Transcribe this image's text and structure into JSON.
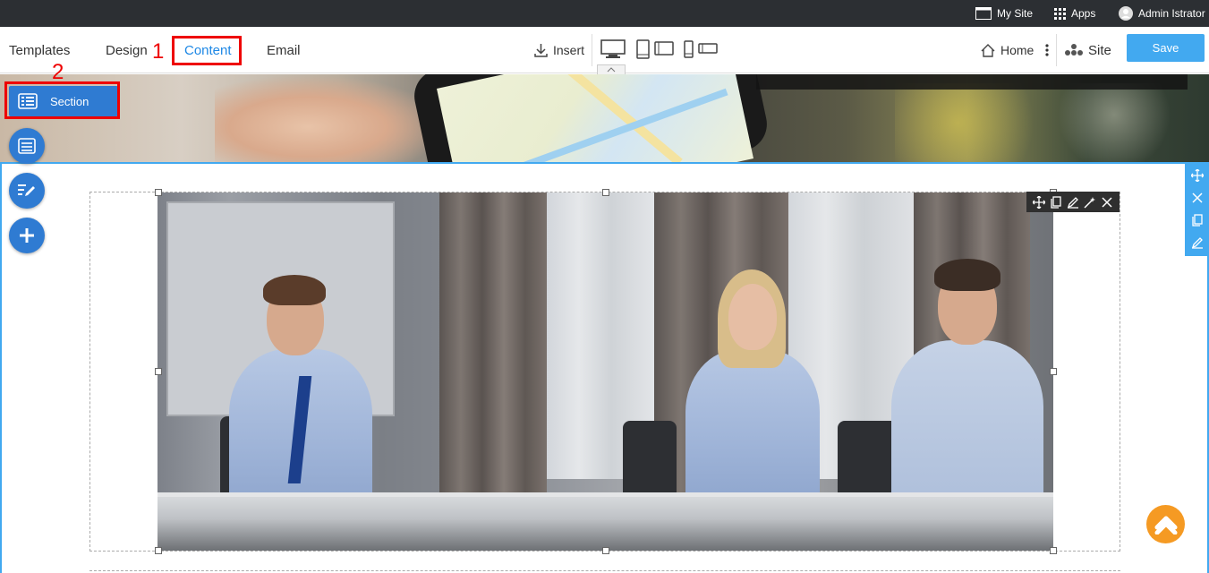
{
  "sysbar": {
    "my_site": "My Site",
    "apps": "Apps",
    "user": "Admin Istrator",
    "icons": [
      "browser-window-icon",
      "apps-grid-icon",
      "user-avatar-icon"
    ]
  },
  "toolbar": {
    "tabs": [
      {
        "label": "Templates"
      },
      {
        "label": "Design"
      },
      {
        "label": "Content",
        "active": true
      },
      {
        "label": "Email"
      }
    ],
    "insert_label": "Insert",
    "devices": [
      "desktop-icon",
      "tablet-portrait-icon",
      "tablet-landscape-icon",
      "mobile-portrait-icon",
      "mobile-landscape-icon"
    ],
    "home_label": "Home",
    "site_label": "Site",
    "save_label": "Save"
  },
  "annotations": {
    "step1": "1",
    "step2": "2"
  },
  "left_panel": {
    "section_label": "Section",
    "fabs": [
      "section-list-icon",
      "edit-content-icon",
      "add-icon"
    ]
  },
  "image_tools": [
    "move-icon",
    "copy-icon",
    "edit-icon",
    "magic-wand-icon",
    "close-icon"
  ],
  "side_tools": [
    "move-icon",
    "close-icon",
    "copy-icon",
    "edit-icon"
  ],
  "colors": {
    "accent": "#42a9f0",
    "active_tab": "#1e88e5",
    "section_button": "#2f7bd2",
    "highlight": "#ee0000",
    "scroll_top": "#f59a23",
    "top_bar": "#2c2f33"
  }
}
